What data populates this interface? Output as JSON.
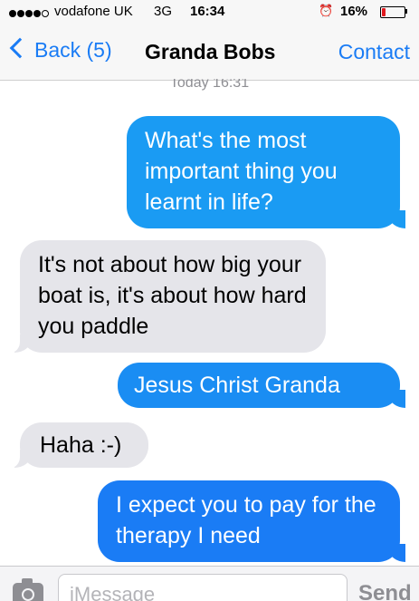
{
  "status_bar": {
    "carrier": "vodafone UK",
    "network": "3G",
    "time": "16:34",
    "battery_percent": "16%",
    "battery_level": 0.16,
    "battery_color": "#e0191e",
    "alarm_icon": "alarm-clock-icon"
  },
  "nav": {
    "back_label": "Back (5)",
    "title": "Granda Bobs",
    "contact_label": "Contact",
    "accent": "#1a7cf5"
  },
  "conversation": {
    "timestamp": "Today 16:31",
    "messages": [
      {
        "direction": "outgoing",
        "text": "What's the most important thing you learnt in life?",
        "color": "#1a9bf3"
      },
      {
        "direction": "incoming",
        "text": "It's not about how big your boat is, it's about how hard you paddle",
        "color": "#e5e5ea"
      },
      {
        "direction": "outgoing",
        "text": "Jesus Christ Granda",
        "color": "#1a8df3"
      },
      {
        "direction": "incoming",
        "text": "Haha :-)",
        "color": "#e5e5ea"
      },
      {
        "direction": "outgoing",
        "text": "I expect you to pay for the therapy I need",
        "color": "#1a7cf5"
      }
    ]
  },
  "input_bar": {
    "placeholder": "iMessage",
    "send_label": "Send",
    "camera_icon": "camera-icon"
  }
}
